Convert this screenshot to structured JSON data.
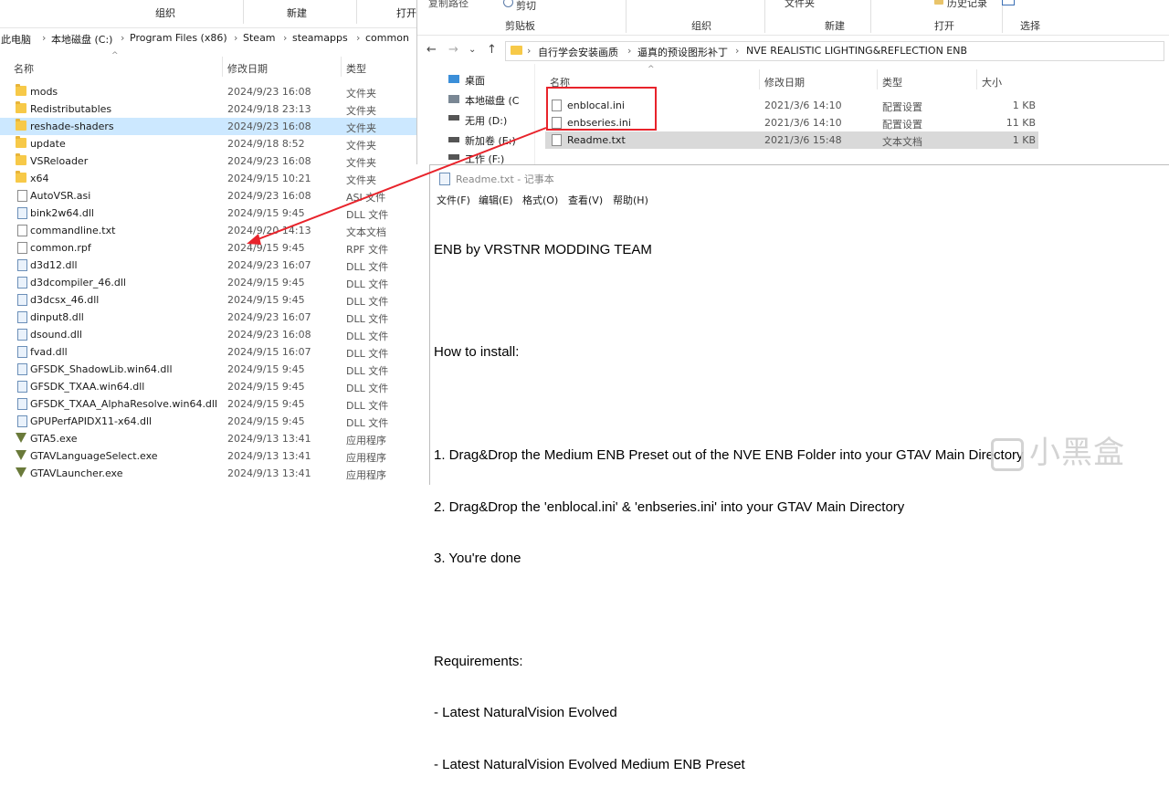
{
  "left_window": {
    "ribbon": {
      "organize": "组织",
      "new": "新建",
      "open": "打开"
    },
    "breadcrumb": [
      "此电脑",
      "本地磁盘 (C:)",
      "Program Files (x86)",
      "Steam",
      "steamapps",
      "common"
    ],
    "columns": {
      "name": "名称",
      "date": "修改日期",
      "type": "类型"
    },
    "files": [
      {
        "name": "mods",
        "date": "2024/9/23 16:08",
        "type": "文件夹",
        "kind": "folder"
      },
      {
        "name": "Redistributables",
        "date": "2024/9/18 23:13",
        "type": "文件夹",
        "kind": "folder"
      },
      {
        "name": "reshade-shaders",
        "date": "2024/9/23 16:08",
        "type": "文件夹",
        "kind": "folder"
      },
      {
        "name": "update",
        "date": "2024/9/18 8:52",
        "type": "文件夹",
        "kind": "folder"
      },
      {
        "name": "VSReloader",
        "date": "2024/9/23 16:08",
        "type": "文件夹",
        "kind": "folder"
      },
      {
        "name": "x64",
        "date": "2024/9/15 10:21",
        "type": "文件夹",
        "kind": "folder"
      },
      {
        "name": "AutoVSR.asi",
        "date": "2024/9/23 16:08",
        "type": "ASI 文件",
        "kind": "file"
      },
      {
        "name": "bink2w64.dll",
        "date": "2024/9/15 9:45",
        "type": "DLL 文件",
        "kind": "dll"
      },
      {
        "name": "commandline.txt",
        "date": "2024/9/20 14:13",
        "type": "文本文档",
        "kind": "file"
      },
      {
        "name": "common.rpf",
        "date": "2024/9/15 9:45",
        "type": "RPF 文件",
        "kind": "file"
      },
      {
        "name": "d3d12.dll",
        "date": "2024/9/23 16:07",
        "type": "DLL 文件",
        "kind": "dll"
      },
      {
        "name": "d3dcompiler_46.dll",
        "date": "2024/9/15 9:45",
        "type": "DLL 文件",
        "kind": "dll"
      },
      {
        "name": "d3dcsx_46.dll",
        "date": "2024/9/15 9:45",
        "type": "DLL 文件",
        "kind": "dll"
      },
      {
        "name": "dinput8.dll",
        "date": "2024/9/23 16:07",
        "type": "DLL 文件",
        "kind": "dll"
      },
      {
        "name": "dsound.dll",
        "date": "2024/9/23 16:08",
        "type": "DLL 文件",
        "kind": "dll"
      },
      {
        "name": "fvad.dll",
        "date": "2024/9/15 16:07",
        "type": "DLL 文件",
        "kind": "dll"
      },
      {
        "name": "GFSDK_ShadowLib.win64.dll",
        "date": "2024/9/15 9:45",
        "type": "DLL 文件",
        "kind": "dll"
      },
      {
        "name": "GFSDK_TXAA.win64.dll",
        "date": "2024/9/15 9:45",
        "type": "DLL 文件",
        "kind": "dll"
      },
      {
        "name": "GFSDK_TXAA_AlphaResolve.win64.dll",
        "date": "2024/9/15 9:45",
        "type": "DLL 文件",
        "kind": "dll"
      },
      {
        "name": "GPUPerfAPIDX11-x64.dll",
        "date": "2024/9/15 9:45",
        "type": "DLL 文件",
        "kind": "dll"
      },
      {
        "name": "GTA5.exe",
        "date": "2024/9/13 13:41",
        "type": "应用程序",
        "kind": "exe"
      },
      {
        "name": "GTAVLanguageSelect.exe",
        "date": "2024/9/13 13:41",
        "type": "应用程序",
        "kind": "exe"
      },
      {
        "name": "GTAVLauncher.exe",
        "date": "2024/9/13 13:41",
        "type": "应用程序",
        "kind": "exe"
      }
    ]
  },
  "right_window": {
    "ribbon": {
      "copy_path": "复制路径",
      "cut": "剪切",
      "clipboard": "剪贴板",
      "organize": "组织",
      "new": "新建",
      "open": "打开",
      "select": "选择",
      "folder_label": "文件夹",
      "history": "历史记录"
    },
    "breadcrumb": [
      "自行学会安装画质",
      "逼真的预设图形补丁",
      "NVE REALISTIC LIGHTING&REFLECTION ENB"
    ],
    "nav": [
      {
        "label": "桌面",
        "icon": "desktop-icon"
      },
      {
        "label": "本地磁盘 (C",
        "icon": "drive-icon"
      },
      {
        "label": "无用 (D:)",
        "icon": "drive-icon"
      },
      {
        "label": "新加卷 (E:)",
        "icon": "drive-icon"
      },
      {
        "label": "工作 (F:)",
        "icon": "drive-icon"
      }
    ],
    "columns": {
      "name": "名称",
      "date": "修改日期",
      "type": "类型",
      "size": "大小"
    },
    "files": [
      {
        "name": "enblocal.ini",
        "date": "2021/3/6 14:10",
        "type": "配置设置",
        "size": "1 KB"
      },
      {
        "name": "enbseries.ini",
        "date": "2021/3/6 14:10",
        "type": "配置设置",
        "size": "11 KB"
      },
      {
        "name": "Readme.txt",
        "date": "2021/3/6 15:48",
        "type": "文本文档",
        "size": "1 KB"
      }
    ]
  },
  "notepad": {
    "title": "Readme.txt - 记事本",
    "menu": [
      "文件(F)",
      "编辑(E)",
      "格式(O)",
      "查看(V)",
      "帮助(H)"
    ],
    "lines": [
      "ENB by VRSTNR MODDING TEAM",
      "",
      "How to install:",
      "",
      "1. Drag&Drop the Medium ENB Preset out of the NVE ENB Folder into your GTAV Main Directory",
      "2. Drag&Drop the 'enblocal.ini' & 'enbseries.ini' into your GTAV Main Directory",
      "3. You're done",
      "",
      "Requirements:",
      "- Latest NaturalVision Evolved",
      "- Latest NaturalVision Evolved Medium ENB Preset"
    ]
  },
  "watermark": "小黑盒",
  "colors": {
    "annotation": "#e8232b",
    "selection": "#cce8ff",
    "folder": "#f7c948"
  }
}
